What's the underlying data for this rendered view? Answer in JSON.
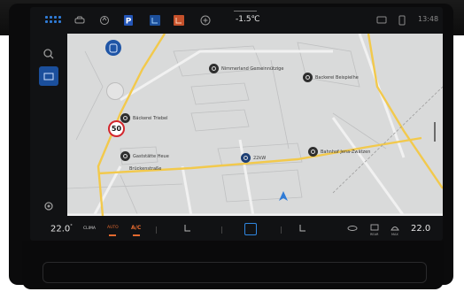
{
  "status_bar": {
    "outside_temp": "-1.5℃",
    "time": "13:48",
    "icons": [
      "apps-grid-icon",
      "car-icon",
      "assist-icon",
      "parking-icon",
      "climate-seat-icon",
      "heated-seat-icon",
      "add-icon",
      "message-icon",
      "phone-icon"
    ]
  },
  "map": {
    "streets": {
      "bruckenstrasse": "Brückenstraße"
    },
    "pois": {
      "p1": "Nimmerland Gemeinnützige",
      "p2": "Backerei Beispielhe",
      "p3": "Bäckerei Triebel",
      "p4": "Gaststätte Heue",
      "p5": "22kW",
      "p6": "Bahnhof Jena-Zwätzen"
    },
    "speed_limit": "50"
  },
  "climate": {
    "driver_temp": "22.0",
    "passenger_temp": "22.0",
    "clima_label": "CLIMA",
    "auto_label": "AUTO",
    "ac_label": "A/C",
    "rear_label": "REAR",
    "max_label": "MAX"
  },
  "colors": {
    "accent_blue": "#2f7bd6",
    "accent_orange": "#e46a2f",
    "route_yellow": "#f2c94c"
  }
}
